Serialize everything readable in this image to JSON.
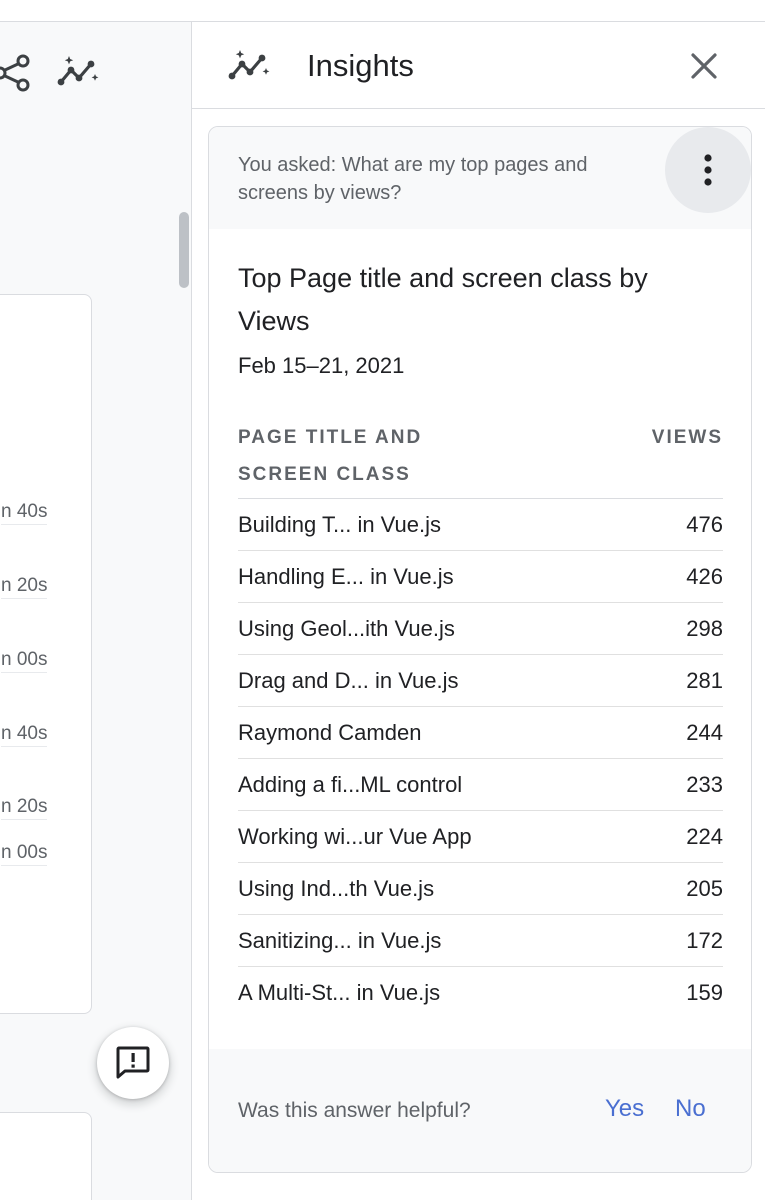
{
  "left_pane": {
    "toolbar_icons": [
      "share-icon",
      "insights-icon"
    ],
    "axis_ticks": [
      "n 40s",
      "n 20s",
      "n 00s",
      "n 40s",
      "n 20s",
      "n 00s"
    ],
    "feedback_icon": "feedback-icon"
  },
  "insights": {
    "title": "Insights",
    "header_icon": "insights-icon",
    "close_icon": "close-icon",
    "question": "You asked: What are my top pages and screens by views?",
    "more_icon": "more-vert-icon",
    "result_title": "Top Page title and screen class by Views",
    "date_range": "Feb 15–21, 2021",
    "table": {
      "headers": {
        "dimension": "PAGE TITLE AND SCREEN CLASS",
        "metric": "VIEWS"
      },
      "rows": [
        {
          "title": "Building T... in Vue.js",
          "views": "476"
        },
        {
          "title": "Handling E... in Vue.js",
          "views": "426"
        },
        {
          "title": "Using Geol...ith Vue.js",
          "views": "298"
        },
        {
          "title": "Drag and D... in Vue.js",
          "views": "281"
        },
        {
          "title": "Raymond Camden",
          "views": "244"
        },
        {
          "title": "Adding a fi...ML control",
          "views": "233"
        },
        {
          "title": "Working wi...ur Vue App",
          "views": "224"
        },
        {
          "title": "Using Ind...th Vue.js",
          "views": "205"
        },
        {
          "title": "Sanitizing... in Vue.js",
          "views": "172"
        },
        {
          "title": "A Multi-St... in Vue.js",
          "views": "159"
        }
      ]
    },
    "feedback": {
      "question": "Was this answer helpful?",
      "yes": "Yes",
      "no": "No"
    }
  },
  "colors": {
    "link": "#4a6fd1",
    "secondary_text": "#5f6368",
    "divider": "#dadce0"
  }
}
